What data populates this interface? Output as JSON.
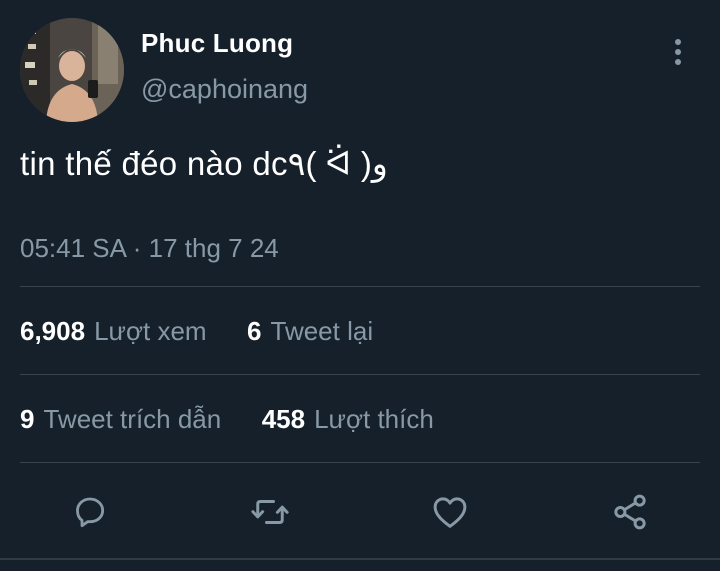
{
  "tweet": {
    "display_name": "Phuc Luong",
    "handle": "@caphoinang",
    "text": "tin thế đéo nào dc٩( ᐛ )و",
    "timestamp": "05:41 SA · 17 thg 7 24"
  },
  "stats": {
    "views_count": "6,908",
    "views_label": "Lượt xem",
    "retweets_count": "6",
    "retweets_label": "Tweet lại",
    "quotes_count": "9",
    "quotes_label": "Tweet trích dẫn",
    "likes_count": "458",
    "likes_label": "Lượt thích"
  },
  "icons": {
    "more": "more-vertical-icon",
    "reply": "reply-icon",
    "retweet": "retweet-icon",
    "like": "heart-icon",
    "share": "share-icon"
  },
  "colors": {
    "background": "#15202b",
    "secondary_text": "#8899a6",
    "divider": "#38444d"
  }
}
